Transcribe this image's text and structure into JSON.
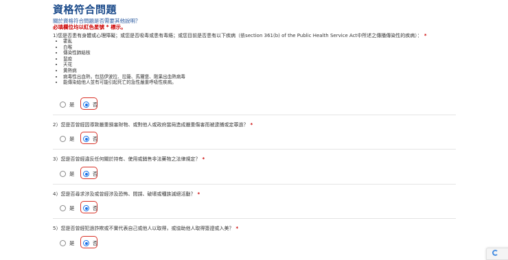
{
  "page": {
    "title": "資格符合問題",
    "subtitle": "關於資格符合問題是否需要其他說明？",
    "required_note": "必填欄位均以紅色星號 * 標示。"
  },
  "q1": {
    "text": "1)您是否患有身體或心理障礙；或您是否吸毒或患有毒瘾；或您目前是否患有以下疾病（依section 361(b) of the Public Health Service Act中所述之傳播傳染性的疾病）：",
    "required_mark": "*",
    "diseases": [
      "霍亂",
      "白喉",
      "傳染性肺結核",
      "鼠疫",
      "天花",
      "黃熱病",
      "病毒性出血熱，包括伊波拉、拉薩、馬爾堡、剛果出血熱病毒",
      "能傳染給他人並有可能引起死亡的急性嚴重呼吸性疾病。"
    ],
    "yes_label": "是",
    "no_label": "否",
    "selected": "否"
  },
  "q2": {
    "text": "2）您是否曾經因導致嚴重損害財物、或對他人或政府當局造成嚴重傷害而被逮捕或定罪過？",
    "required_mark": "*",
    "yes_label": "是",
    "no_label": "否",
    "selected": "否"
  },
  "q3": {
    "text": "3）您是否曾經違反任何關於持有、使用或銷售非法藥物之法律規定？",
    "required_mark": "*",
    "yes_label": "是",
    "no_label": "否",
    "selected": "否"
  },
  "q4": {
    "text": "4）您是否尋求涉及或曾經涉及恐怖、間諜、破壞或種族滅絕活動？",
    "required_mark": "*",
    "yes_label": "是",
    "no_label": "否",
    "selected": "否"
  },
  "q5": {
    "text": "5）您是否曾經犯過詐欺或不實代表自己或他人以取得，或協助他人取得簽證或入美？",
    "required_mark": "*",
    "yes_label": "是",
    "no_label": "否",
    "selected": "否"
  },
  "colors": {
    "title": "#1a4a8a",
    "required": "#cc0000",
    "radio_selected": "#1a73e8",
    "highlight_outline": "#d93025"
  },
  "icons": {
    "recaptcha": "recaptcha-badge-icon"
  }
}
